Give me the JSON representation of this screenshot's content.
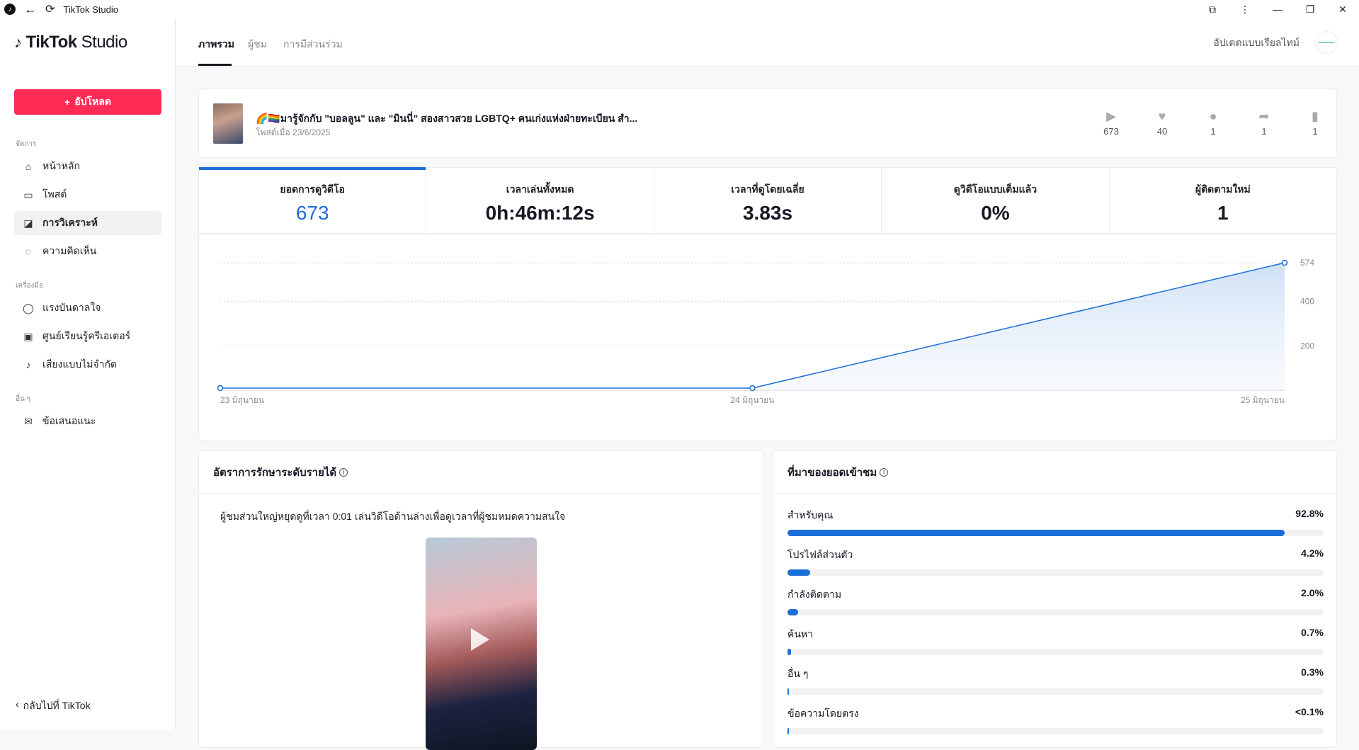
{
  "window": {
    "title": "TikTok Studio"
  },
  "brand": {
    "name": "TikTok",
    "suffix": "Studio"
  },
  "sidebar": {
    "upload_label": "อัปโหลด",
    "sections": [
      "จัดการ",
      "เครื่องมือ",
      "อื่น ๆ"
    ],
    "items": [
      {
        "label": "หน้าหลัก"
      },
      {
        "label": "โพสต์"
      },
      {
        "label": "การวิเคราะห์"
      },
      {
        "label": "ความคิดเห็น"
      },
      {
        "label": "แรงบันดาลใจ"
      },
      {
        "label": "ศูนย์เรียนรู้ครีเอเตอร์"
      },
      {
        "label": "เสียงแบบไม่จำกัด"
      },
      {
        "label": "ข้อเสนอแนะ"
      }
    ],
    "back_label": "กลับไปที่ TikTok"
  },
  "topnav": {
    "tabs": [
      "ภาพรวม",
      "ผู้ชม",
      "การมีส่วนร่วม"
    ],
    "realtime_label": "อัปเดตแบบเรียลไทม์"
  },
  "post": {
    "title": "🌈🏳️‍🌈มารู้จักกับ \"บอลลูน\" และ \"มินนี่\" สองสาวสวย LGBTQ+ คนเก่งแห่งฝ่ายทะเบียน สำ...",
    "date": "โพสต์เมื่อ 23/6/2025",
    "stats": {
      "views": "673",
      "likes": "40",
      "comments": "1",
      "shares": "1",
      "saves": "1"
    }
  },
  "kpis": [
    {
      "label": "ยอดการดูวิดีโอ",
      "value": "673"
    },
    {
      "label": "เวลาเล่นทั้งหมด",
      "value": "0h:46m:12s"
    },
    {
      "label": "เวลาที่ดูโดยเฉลี่ย",
      "value": "3.83s"
    },
    {
      "label": "ดูวิดีโอแบบเต็มแล้ว",
      "value": "0%"
    },
    {
      "label": "ผู้ติดตามใหม่",
      "value": "1"
    }
  ],
  "chart_data": {
    "type": "area",
    "categories": [
      "23 มิถุนายน",
      "24 มิถุนายน",
      "25 มิถุนายน"
    ],
    "values": [
      0,
      0,
      574
    ],
    "y_ticks": [
      200,
      400,
      574
    ],
    "ylim": [
      0,
      574
    ],
    "grid": true,
    "color": "#1a6ed8"
  },
  "retention": {
    "title": "อัตราการรักษาระดับรายได้",
    "text": "ผู้ชมส่วนใหญ่หยุดดูที่เวลา 0:01 เล่นวิดีโอด้านล่างเพื่อดูเวลาที่ผู้ชมหมดความสนใจ"
  },
  "sources": {
    "title": "ที่มาของยอดเข้าชม",
    "rows": [
      {
        "label": "สำหรับคุณ",
        "value": "92.8%",
        "pct": 92.8
      },
      {
        "label": "โปรไฟล์ส่วนตัว",
        "value": "4.2%",
        "pct": 4.2
      },
      {
        "label": "กำลังติดตาม",
        "value": "2.0%",
        "pct": 2.0
      },
      {
        "label": "ค้นหา",
        "value": "0.7%",
        "pct": 0.7
      },
      {
        "label": "อื่น ๆ",
        "value": "0.3%",
        "pct": 0.3
      },
      {
        "label": "ข้อความโดยตรง",
        "value": "<0.1%",
        "pct": 0.05
      }
    ]
  }
}
